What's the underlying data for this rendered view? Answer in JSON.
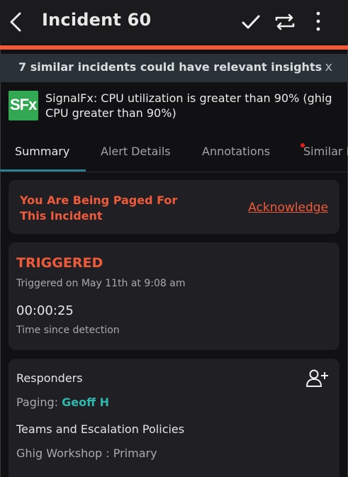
{
  "header": {
    "title": "Incident 60",
    "back_icon": "chevron-left-icon",
    "icons": [
      "checkmark-icon",
      "reassign-icon",
      "more-vertical-icon"
    ]
  },
  "colors": {
    "accent": "#ef5a3a",
    "teal": "#2eb8ad",
    "tab_underline": "#2b7f91",
    "banner_bg": "#2a3238",
    "background": "#111114",
    "card_bg": "#202024",
    "signalfx_green": "#33a852"
  },
  "banner": {
    "text": "7 similar incidents could have relevant insights",
    "close": "x"
  },
  "incident": {
    "logo_text": "SFx",
    "description": "SignalFx: CPU utilization is greater than 90% (ghig\nCPU greater than 90%)"
  },
  "tabs": [
    {
      "label": "Summary"
    },
    {
      "label": "Alert Details"
    },
    {
      "label": "Annotations"
    },
    {
      "label": "Similar I"
    }
  ],
  "paged_card": {
    "title": "You Are Being Paged For\nThis Incident",
    "action": "Acknowledge"
  },
  "status_card": {
    "status": "TRIGGERED",
    "triggered_on": "Triggered on May 11th at 9:08 am",
    "elapsed": "00:00:25",
    "elapsed_label": "Time since detection"
  },
  "responders_card": {
    "title": "Responders",
    "add_icon": "add-person-icon",
    "paging_label": "Paging:",
    "paging_name": "Geoff H",
    "teams_title": "Teams and Escalation Policies",
    "policy": "Ghig Workshop : Primary"
  }
}
